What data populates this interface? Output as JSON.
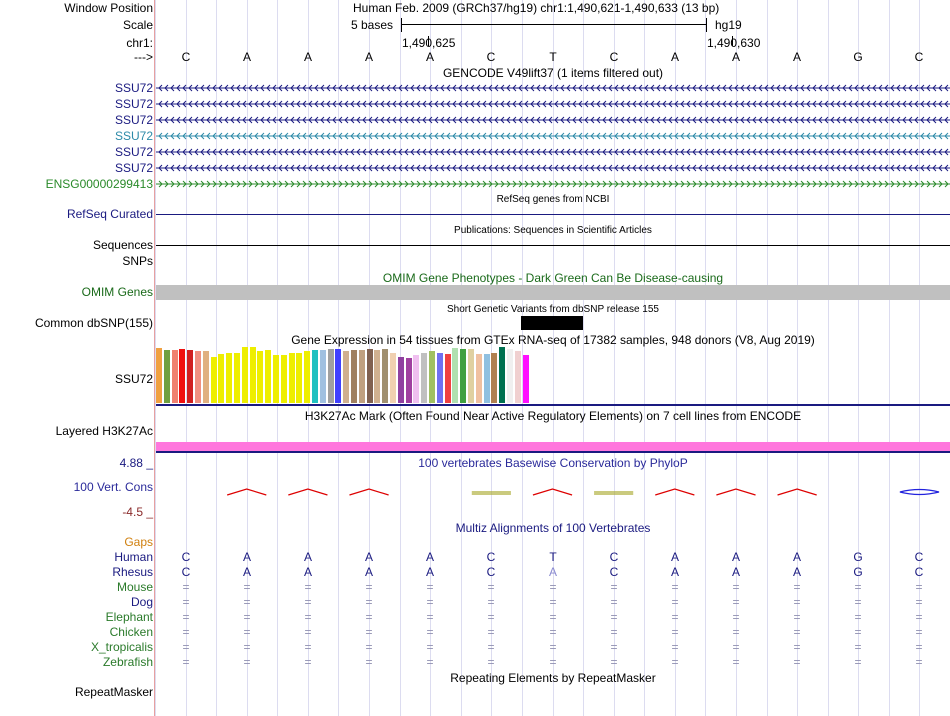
{
  "header": {
    "window_position_label": "Window Position",
    "scale_label": "Scale",
    "chrom_label": "chr1:",
    "arrow_label": "--->",
    "assembly_text": "Human Feb. 2009 (GRCh37/hg19)   chr1:1,490,621-1,490,633 (13 bp)",
    "scale_text": "5 bases",
    "db_text": "hg19",
    "coord_left": "1,490,625",
    "coord_right": "1,490,630"
  },
  "bases": [
    "C",
    "A",
    "A",
    "A",
    "A",
    "C",
    "T",
    "C",
    "A",
    "A",
    "A",
    "G",
    "C"
  ],
  "gencode": {
    "title": "GENCODE V49lift37 (1 items filtered out)",
    "genes": [
      {
        "name": "SSU72",
        "color": "#1a1a80",
        "strand": "minus"
      },
      {
        "name": "SSU72",
        "color": "#1a1a80",
        "strand": "minus"
      },
      {
        "name": "SSU72",
        "color": "#1a1a80",
        "strand": "minus"
      },
      {
        "name": "SSU72",
        "color": "#2c8aa8",
        "strand": "minus"
      },
      {
        "name": "SSU72",
        "color": "#1a1a80",
        "strand": "minus"
      },
      {
        "name": "SSU72",
        "color": "#1a1a80",
        "strand": "minus"
      },
      {
        "name": "ENSG00000299413",
        "color": "#2a8a2a",
        "strand": "plus"
      }
    ]
  },
  "refseq": {
    "label": "RefSeq Curated",
    "title": "RefSeq genes from NCBI",
    "color": "#1a1a80"
  },
  "sequences": {
    "label": "Sequences",
    "title": "Publications: Sequences in Scientific Articles"
  },
  "snps": {
    "label": "SNPs"
  },
  "omim": {
    "label": "OMIM Genes",
    "title": "OMIM Gene Phenotypes - Dark Green Can Be Disease-causing",
    "color": "#1a6a1a"
  },
  "dbsnp": {
    "label": "Common dbSNP(155)",
    "title": "Short Genetic Variants from dbSNP release 155"
  },
  "gtex": {
    "label": "SSU72",
    "title": "Gene Expression in 54 tissues from GTEx RNA-seq of 17382 samples, 948 donors (V8, Aug 2019)",
    "bars": [
      {
        "color": "#f0a040",
        "value": 0.98
      },
      {
        "color": "#70a040",
        "value": 0.95
      },
      {
        "color": "#f08070",
        "value": 0.95
      },
      {
        "color": "#f01010",
        "value": 0.96
      },
      {
        "color": "#d02020",
        "value": 0.95
      },
      {
        "color": "#f09080",
        "value": 0.92
      },
      {
        "color": "#e0b080",
        "value": 0.93
      },
      {
        "color": "#eeee00",
        "value": 0.82
      },
      {
        "color": "#eeee00",
        "value": 0.88
      },
      {
        "color": "#eeee00",
        "value": 0.9
      },
      {
        "color": "#eeee00",
        "value": 0.9
      },
      {
        "color": "#eeee00",
        "value": 1.0
      },
      {
        "color": "#eeee00",
        "value": 1.0
      },
      {
        "color": "#eeee00",
        "value": 0.92
      },
      {
        "color": "#eeee00",
        "value": 0.95
      },
      {
        "color": "#eeee00",
        "value": 0.85
      },
      {
        "color": "#eeee00",
        "value": 0.85
      },
      {
        "color": "#eeee00",
        "value": 0.9
      },
      {
        "color": "#eeee00",
        "value": 0.9
      },
      {
        "color": "#eeee00",
        "value": 0.92
      },
      {
        "color": "#20c0c0",
        "value": 0.95
      },
      {
        "color": "#a0c0e0",
        "value": 0.95
      },
      {
        "color": "#a0a0a0",
        "value": 0.96
      },
      {
        "color": "#4040ff",
        "value": 0.96
      },
      {
        "color": "#d0b090",
        "value": 0.92
      },
      {
        "color": "#a08060",
        "value": 0.95
      },
      {
        "color": "#c0a080",
        "value": 0.94
      },
      {
        "color": "#806050",
        "value": 0.96
      },
      {
        "color": "#d0b090",
        "value": 0.95
      },
      {
        "color": "#a09070",
        "value": 0.96
      },
      {
        "color": "#f0d0b0",
        "value": 0.9
      },
      {
        "color": "#9040a0",
        "value": 0.82
      },
      {
        "color": "#a040a0",
        "value": 0.8
      },
      {
        "color": "#f0c0f0",
        "value": 0.86
      },
      {
        "color": "#c0c0c0",
        "value": 0.9
      },
      {
        "color": "#a0c060",
        "value": 0.92
      },
      {
        "color": "#7070f0",
        "value": 0.9
      },
      {
        "color": "#f04040",
        "value": 0.88
      },
      {
        "color": "#b0e0b0",
        "value": 0.98
      },
      {
        "color": "#40a040",
        "value": 0.96
      },
      {
        "color": "#e0d0a0",
        "value": 0.96
      },
      {
        "color": "#f0c0a0",
        "value": 0.88
      },
      {
        "color": "#90c0e0",
        "value": 0.88
      },
      {
        "color": "#b08050",
        "value": 0.9
      },
      {
        "color": "#007050",
        "value": 1.0
      },
      {
        "color": "#f0f0f0",
        "value": 0.96
      },
      {
        "color": "#f0d0d0",
        "value": 0.92
      },
      {
        "color": "#ff10ff",
        "value": 0.86
      }
    ]
  },
  "h3k27ac": {
    "label": "Layered H3K27Ac",
    "title": "H3K27Ac Mark (Often Found Near Active Regulatory Elements) on 7 cell lines from ENCODE",
    "color": "#ff77dd"
  },
  "phylop": {
    "label": "100 Vert. Cons",
    "top": "4.88 _",
    "bottom": "-4.5 _",
    "title": "100 vertebrates Basewise Conservation by PhyloP",
    "values": [
      0,
      0.8,
      0.8,
      0.8,
      0,
      0.25,
      0.6,
      0.25,
      0.5,
      0.5,
      0.7,
      0,
      -0.6
    ]
  },
  "multiz": {
    "title": "Multiz Alignments of 100 Vertebrates",
    "gaps_label": "Gaps",
    "species": [
      {
        "name": "Human",
        "color": "#1a1a80",
        "row": [
          "C",
          "A",
          "A",
          "A",
          "A",
          "C",
          "T",
          "C",
          "A",
          "A",
          "A",
          "G",
          "C"
        ]
      },
      {
        "name": "Rhesus",
        "color": "#1a1a80",
        "row": [
          "C",
          "A",
          "A",
          "A",
          "A",
          "C",
          "A",
          "C",
          "A",
          "A",
          "A",
          "G",
          "C"
        ]
      },
      {
        "name": "Mouse",
        "color": "#2a7a2a",
        "row": [
          "=",
          "=",
          "=",
          "=",
          "=",
          "=",
          "=",
          "=",
          "=",
          "=",
          "=",
          "=",
          "="
        ]
      },
      {
        "name": "Dog",
        "color": "#1a1a80",
        "row": [
          "=",
          "=",
          "=",
          "=",
          "=",
          "=",
          "=",
          "=",
          "=",
          "=",
          "=",
          "=",
          "="
        ]
      },
      {
        "name": "Elephant",
        "color": "#2a7a2a",
        "row": [
          "=",
          "=",
          "=",
          "=",
          "=",
          "=",
          "=",
          "=",
          "=",
          "=",
          "=",
          "=",
          "="
        ]
      },
      {
        "name": "Chicken",
        "color": "#2a7a2a",
        "row": [
          "=",
          "=",
          "=",
          "=",
          "=",
          "=",
          "=",
          "=",
          "=",
          "=",
          "=",
          "=",
          "="
        ]
      },
      {
        "name": "X_tropicalis",
        "color": "#2a7a2a",
        "row": [
          "=",
          "=",
          "=",
          "=",
          "=",
          "=",
          "=",
          "=",
          "=",
          "=",
          "=",
          "=",
          "="
        ]
      },
      {
        "name": "Zebrafish",
        "color": "#2a7a2a",
        "row": [
          "=",
          "=",
          "=",
          "=",
          "=",
          "=",
          "=",
          "=",
          "=",
          "=",
          "=",
          "=",
          "="
        ]
      }
    ]
  },
  "repeatmasker": {
    "label": "RepeatMasker",
    "title": "Repeating Elements by RepeatMasker"
  },
  "colors": {
    "navy": "#1a1a80",
    "gaps": "#d08010",
    "omim_gray": "#c0c0c0",
    "pink": "#ff77dd",
    "separator": "#1a1a80"
  }
}
